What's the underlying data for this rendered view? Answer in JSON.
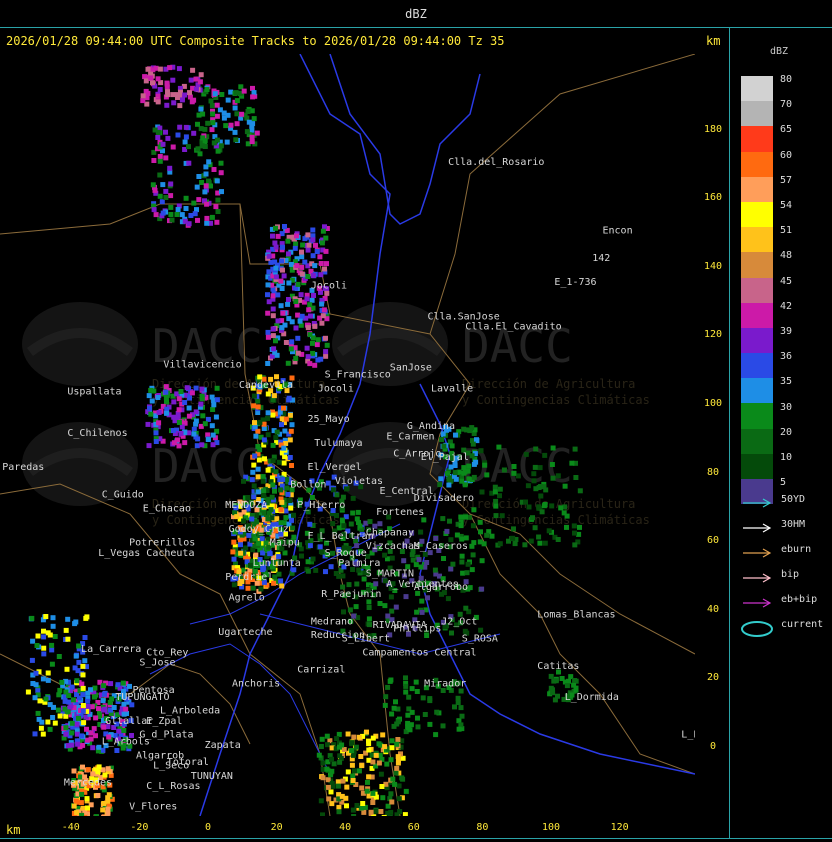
{
  "window_title": "dBZ",
  "header": {
    "title": "2026/01/28 09:44:00 UTC Composite Tracks to 2026/01/28 09:44:00 Tz 35",
    "km_top": "km",
    "km_bottom": "km"
  },
  "axes": {
    "x_ticks": [
      "-40",
      "-20",
      "0",
      "20",
      "40",
      "60",
      "80",
      "100",
      "120"
    ],
    "x_values": [
      -40,
      -20,
      0,
      20,
      40,
      60,
      80,
      100,
      120
    ],
    "y_ticks": [
      "180",
      "160",
      "140",
      "120",
      "100",
      "80",
      "60",
      "40",
      "20",
      "0"
    ],
    "y_values": [
      180,
      160,
      140,
      120,
      100,
      80,
      60,
      40,
      20,
      0
    ]
  },
  "legend": {
    "title": "dBZ",
    "levels": [
      "80",
      "70",
      "65",
      "60",
      "57",
      "54",
      "51",
      "48",
      "45",
      "42",
      "39",
      "36",
      "35",
      "30",
      "20",
      "10",
      "5"
    ],
    "colors": [
      "#d2d2d2",
      "#b4b4b4",
      "#ff3a1a",
      "#ff6a10",
      "#ff9e5a",
      "#ffff00",
      "#ffc21a",
      "#d78a3a",
      "#c8648a",
      "#cc1aa8",
      "#7a1acc",
      "#2a4ae6",
      "#1e8ee6",
      "#0a8a1a",
      "#0a6a14",
      "#044a0a",
      "#4a3a8e"
    ]
  },
  "track_legend": [
    {
      "label": "50YD",
      "color": "#33cccc"
    },
    {
      "label": "30HM",
      "color": "#ffffff"
    },
    {
      "label": "eburn",
      "color": "#e0a050"
    },
    {
      "label": "bip",
      "color": "#ffc0cb"
    },
    {
      "label": "eb+bip",
      "color": "#cc33cc"
    },
    {
      "label": "current",
      "color": "#33cccc"
    }
  ],
  "watermark": {
    "brand": "DACC",
    "line1": "Dirección de Agricultura",
    "line2": "y Contingencias Climáticas"
  },
  "places": [
    {
      "name": "Clla.del_Rosario",
      "x": 70,
      "y": 170
    },
    {
      "name": "Encon",
      "x": 115,
      "y": 150
    },
    {
      "name": "142",
      "x": 112,
      "y": 142
    },
    {
      "name": "E_1-736",
      "x": 101,
      "y": 135
    },
    {
      "name": "Clla.SanJose",
      "x": 64,
      "y": 125
    },
    {
      "name": "Clla.El_Cavadito",
      "x": 75,
      "y": 122
    },
    {
      "name": "Jocoli",
      "x": 30,
      "y": 134
    },
    {
      "name": "Uspallata",
      "x": -41,
      "y": 103
    },
    {
      "name": "Villavicencio",
      "x": -13,
      "y": 111
    },
    {
      "name": "S_Francisco",
      "x": 34,
      "y": 108
    },
    {
      "name": "SanJose",
      "x": 53,
      "y": 110
    },
    {
      "name": "Capdevila",
      "x": 9,
      "y": 105
    },
    {
      "name": "Jocoli",
      "x": 32,
      "y": 104
    },
    {
      "name": "Lavalle",
      "x": 65,
      "y": 104
    },
    {
      "name": "C_Chilenos",
      "x": -41,
      "y": 91
    },
    {
      "name": "25_Mayo",
      "x": 29,
      "y": 95
    },
    {
      "name": "Tulumaya",
      "x": 31,
      "y": 88
    },
    {
      "name": "E_Carmen",
      "x": 52,
      "y": 90
    },
    {
      "name": "G_Andina",
      "x": 58,
      "y": 93
    },
    {
      "name": "C_Arrojo",
      "x": 54,
      "y": 85
    },
    {
      "name": "El_Pajal",
      "x": 62,
      "y": 84
    },
    {
      "name": "Paredas",
      "x": -60,
      "y": 81
    },
    {
      "name": "El_Vergel",
      "x": 29,
      "y": 81
    },
    {
      "name": "Violetas",
      "x": 37,
      "y": 77
    },
    {
      "name": "E_Central",
      "x": 50,
      "y": 74
    },
    {
      "name": "Divisadero",
      "x": 60,
      "y": 72
    },
    {
      "name": "Bollon",
      "x": 24,
      "y": 76
    },
    {
      "name": "P_Hierro",
      "x": 26,
      "y": 70
    },
    {
      "name": "Fortenes",
      "x": 49,
      "y": 68
    },
    {
      "name": "C_Guido",
      "x": -31,
      "y": 73
    },
    {
      "name": "E_Chacao",
      "x": -19,
      "y": 69
    },
    {
      "name": "MENDOZA",
      "x": 5,
      "y": 70
    },
    {
      "name": "Godoy_Cruz",
      "x": 6,
      "y": 63
    },
    {
      "name": "F_L_Beltran",
      "x": 29,
      "y": 61
    },
    {
      "name": "Chapanay",
      "x": 46,
      "y": 62
    },
    {
      "name": "Vizcachas",
      "x": 46,
      "y": 58
    },
    {
      "name": "M_Caseros",
      "x": 60,
      "y": 58
    },
    {
      "name": "Potrerillos",
      "x": -23,
      "y": 59
    },
    {
      "name": "L_Vegas",
      "x": -32,
      "y": 56
    },
    {
      "name": "Cacheuta",
      "x": -18,
      "y": 56
    },
    {
      "name": "Maipu",
      "x": 18,
      "y": 59
    },
    {
      "name": "S_Roque",
      "x": 34,
      "y": 56
    },
    {
      "name": "Palmira",
      "x": 38,
      "y": 53
    },
    {
      "name": "Lunlunta",
      "x": 13,
      "y": 53
    },
    {
      "name": "S_MARTIN",
      "x": 46,
      "y": 50
    },
    {
      "name": "Perdriel",
      "x": 5,
      "y": 49
    },
    {
      "name": "A_Vertientes",
      "x": 52,
      "y": 47
    },
    {
      "name": "Algarrobo",
      "x": 60,
      "y": 46
    },
    {
      "name": "Agrelo",
      "x": 6,
      "y": 43
    },
    {
      "name": "R_Paejunin",
      "x": 33,
      "y": 44
    },
    {
      "name": "Ugarteche",
      "x": 3,
      "y": 33
    },
    {
      "name": "Medrano",
      "x": 30,
      "y": 36
    },
    {
      "name": "RIVADAVIA",
      "x": 48,
      "y": 35
    },
    {
      "name": "J2_Oct",
      "x": 68,
      "y": 36
    },
    {
      "name": "Lomas_Blancas",
      "x": 96,
      "y": 38
    },
    {
      "name": "Phillips",
      "x": 54,
      "y": 34
    },
    {
      "name": "Reduccion",
      "x": 30,
      "y": 32
    },
    {
      "name": "S_Libert",
      "x": 39,
      "y": 31
    },
    {
      "name": "S_ROSA",
      "x": 74,
      "y": 31
    },
    {
      "name": "La_Carrera",
      "x": -37,
      "y": 28
    },
    {
      "name": "Cto_Rey",
      "x": -18,
      "y": 27
    },
    {
      "name": "S_Jose",
      "x": -20,
      "y": 24
    },
    {
      "name": "Campamentos",
      "x": 45,
      "y": 27
    },
    {
      "name": "Central",
      "x": 66,
      "y": 27
    },
    {
      "name": "Carrizal",
      "x": 26,
      "y": 22
    },
    {
      "name": "Catitas",
      "x": 96,
      "y": 23
    },
    {
      "name": "Anchoris",
      "x": 7,
      "y": 18
    },
    {
      "name": "Pentosa",
      "x": -22,
      "y": 16
    },
    {
      "name": "TUPUNGATO",
      "x": -27,
      "y": 14
    },
    {
      "name": "Mirador",
      "x": 63,
      "y": 18
    },
    {
      "name": "L_Dormida",
      "x": 104,
      "y": 14
    },
    {
      "name": "L_Arboleda",
      "x": -14,
      "y": 10
    },
    {
      "name": "Gltallar",
      "x": -30,
      "y": 7
    },
    {
      "name": "E_Zpal",
      "x": -18,
      "y": 7
    },
    {
      "name": "L_Arbols",
      "x": -31,
      "y": 1
    },
    {
      "name": "G_d_Plata",
      "x": -20,
      "y": 3
    },
    {
      "name": "Zapata",
      "x": -1,
      "y": 0
    },
    {
      "name": "Algarrob",
      "x": -21,
      "y": -3
    },
    {
      "name": "Totoral",
      "x": -12,
      "y": -5
    },
    {
      "name": "L_Seco",
      "x": -16,
      "y": -6
    },
    {
      "name": "L_PAZ",
      "x": 138,
      "y": 3
    },
    {
      "name": "Mercedes",
      "x": -42,
      "y": -11
    },
    {
      "name": "TUNUYAN",
      "x": -5,
      "y": -9
    },
    {
      "name": "C_L_Rosas",
      "x": -18,
      "y": -12
    },
    {
      "name": "V_Flores",
      "x": -23,
      "y": -18
    }
  ]
}
